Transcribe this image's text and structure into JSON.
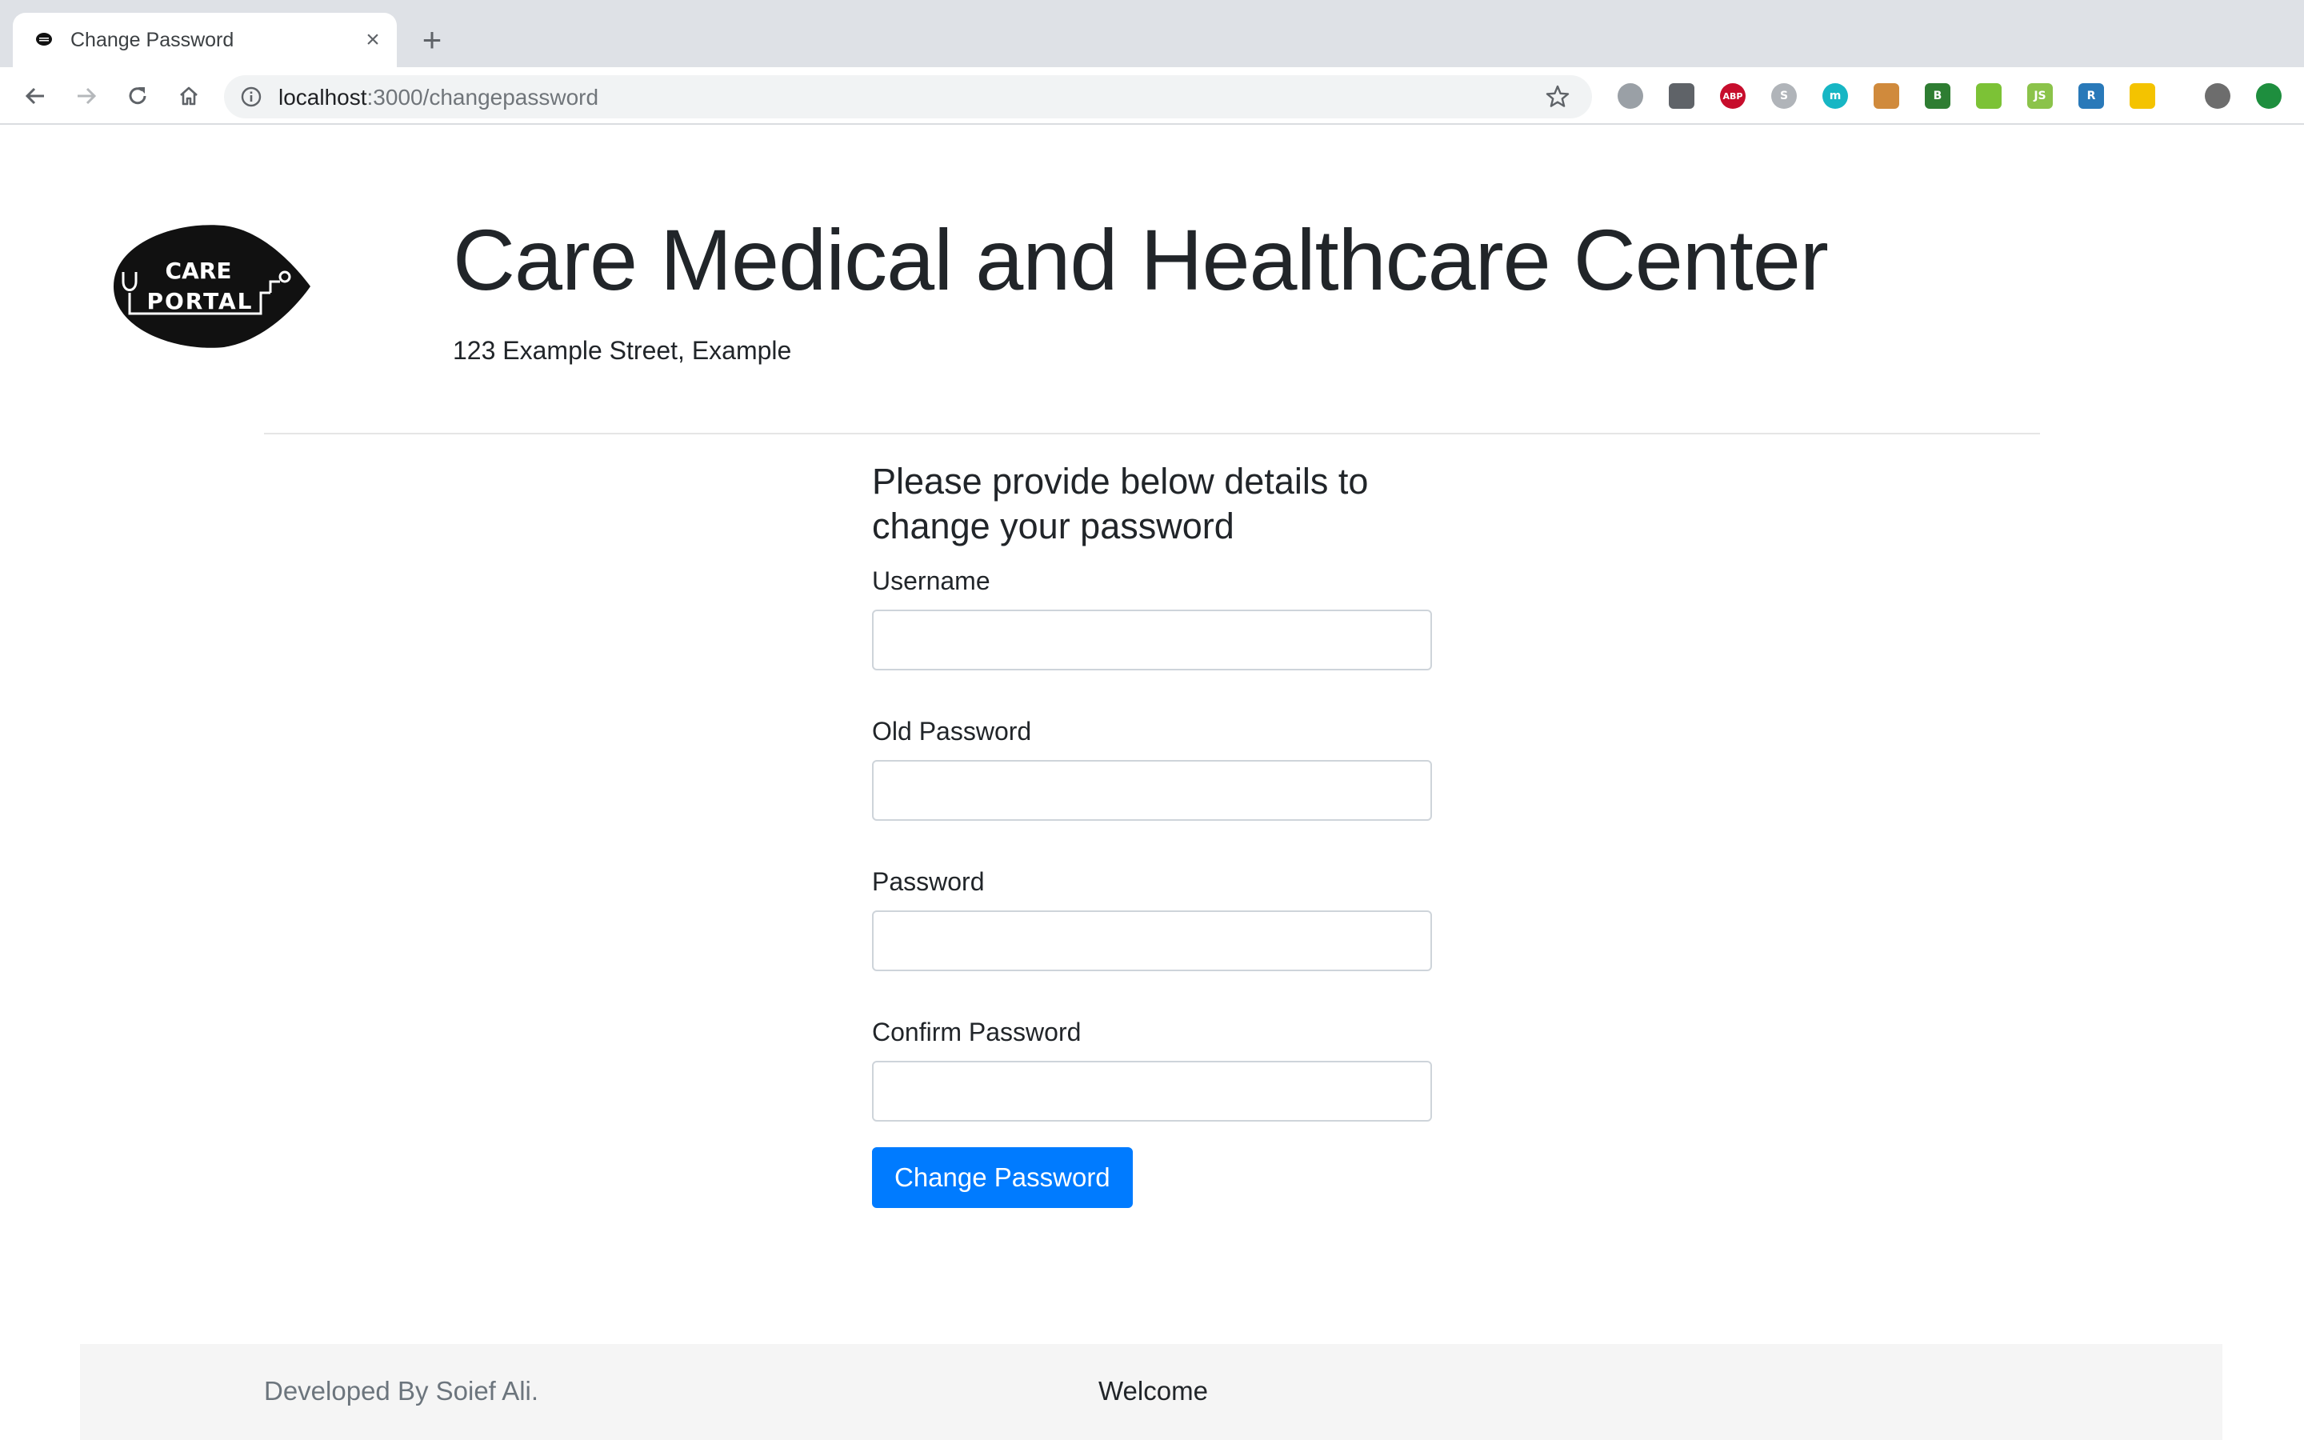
{
  "browser": {
    "tab_title": "Change Password",
    "url_host": "localhost",
    "url_path": ":3000/changepassword",
    "extensions": [
      {
        "icon": "circle-ext-icon",
        "label": "",
        "color": "#9aa0a6"
      },
      {
        "icon": "bulb-ext-icon",
        "label": "",
        "color": "#5f6368"
      },
      {
        "icon": "adblock-ext-icon",
        "label": "ABP",
        "color": "#c70d2c"
      },
      {
        "icon": "skype-ext-icon",
        "label": "S",
        "color": "#b0b4b9"
      },
      {
        "icon": "m-ext-icon",
        "label": "m",
        "color": "#17b6c4"
      },
      {
        "icon": "cookie-ext-icon",
        "label": "",
        "color": "#d08a3c"
      },
      {
        "icon": "b-ext-icon",
        "label": "B",
        "color": "#2e7d32"
      },
      {
        "icon": "hex-ext-icon",
        "label": "",
        "color": "#7cc236"
      },
      {
        "icon": "js-ext-icon",
        "label": "JS",
        "color": "#8bc34a"
      },
      {
        "icon": "r-ext-icon",
        "label": "R",
        "color": "#2979b9"
      },
      {
        "icon": "mail-ext-icon",
        "label": "",
        "color": "#f4c300"
      },
      {
        "icon": "avatar-icon",
        "label": "",
        "color": "#6d6d6d"
      },
      {
        "icon": "update-icon",
        "label": "",
        "color": "#1e8e3e"
      }
    ]
  },
  "header": {
    "logo_line1": "CARE",
    "logo_line2": "PORTAL",
    "title": "Care Medical and Healthcare Center",
    "address": "123 Example Street, Example"
  },
  "form": {
    "heading": "Please provide below details to change your password",
    "fields": [
      {
        "label": "Username",
        "value": "",
        "placeholder": ""
      },
      {
        "label": "Old Password",
        "value": "",
        "placeholder": ""
      },
      {
        "label": "Password",
        "value": "",
        "placeholder": ""
      },
      {
        "label": "Confirm Password",
        "value": "",
        "placeholder": ""
      }
    ],
    "submit_label": "Change Password"
  },
  "footer": {
    "developer": "Developed By Soief Ali.",
    "welcome": "Welcome"
  },
  "colors": {
    "primary": "#007bff",
    "text": "#212529",
    "muted": "#6c757d",
    "footer_bg": "#f5f5f5"
  }
}
